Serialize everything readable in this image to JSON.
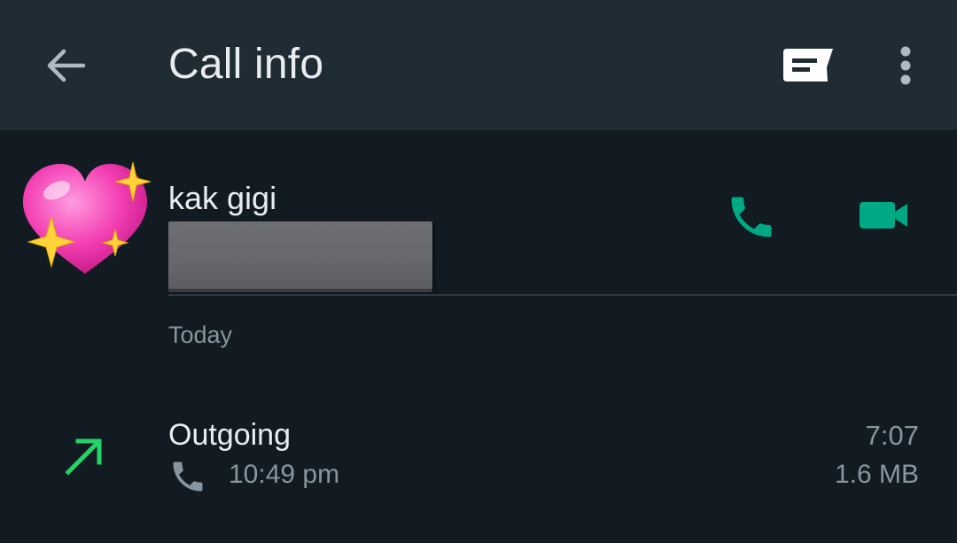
{
  "appbar": {
    "title": "Call info",
    "back_icon": "arrow-left-icon",
    "message_icon": "message-icon",
    "more_icon": "more-vertical-icon"
  },
  "contact": {
    "name": "kak gigi",
    "avatar": "sparkling-heart-emoji",
    "voice_call_icon": "phone-icon",
    "video_call_icon": "videocam-icon"
  },
  "section": {
    "label": "Today"
  },
  "call": {
    "type": "Outgoing",
    "direction_icon": "outgoing-arrow-icon",
    "time": "10:49 pm",
    "duration": "7:07",
    "size": "1.6 MB"
  },
  "colors": {
    "appbar_bg": "#1f2c34",
    "body_bg": "#121b22",
    "accent_green": "#00a884",
    "outgoing_green": "#25d366",
    "secondary_text": "#8696a0",
    "primary_text": "#e9edef"
  }
}
